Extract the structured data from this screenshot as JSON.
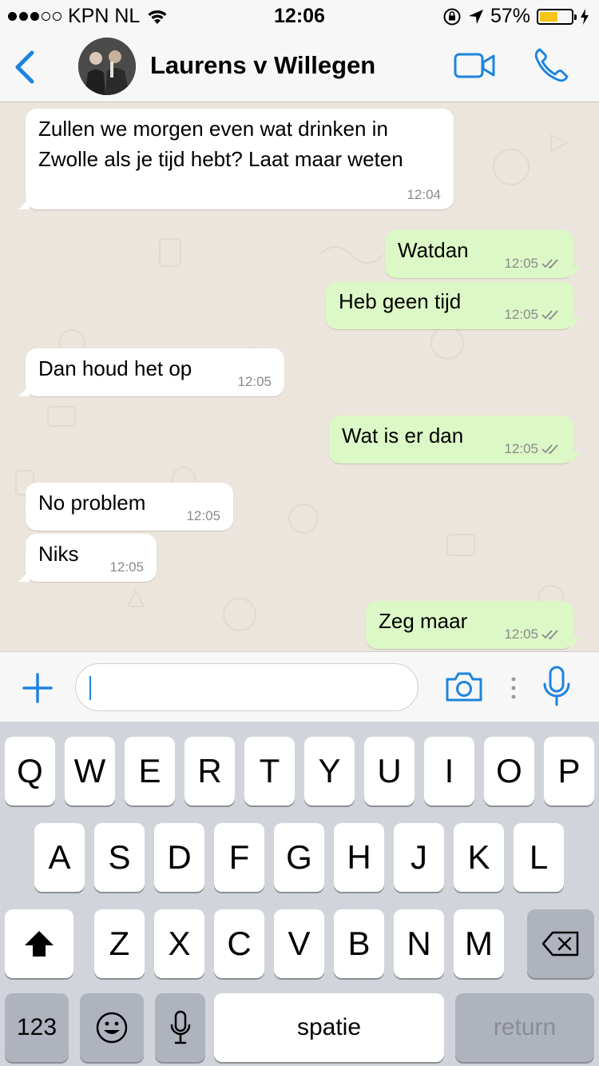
{
  "status_bar": {
    "carrier": "KPN NL",
    "time": "12:06",
    "battery_percent": "57%",
    "battery_level": 0.57,
    "signal_bars_filled": 3,
    "signal_bars_total": 5
  },
  "nav": {
    "contact_name": "Laurens v Willegen"
  },
  "messages": [
    {
      "direction": "incoming",
      "text": "Zullen we morgen even wat drinken in\nZwolle als je tijd hebt? Laat maar weten",
      "time": "12:04"
    },
    {
      "direction": "outgoing",
      "text": "Watdan",
      "time": "12:05",
      "read": true
    },
    {
      "direction": "outgoing",
      "text": "Heb geen tijd",
      "time": "12:05",
      "read": true
    },
    {
      "direction": "incoming",
      "text": "Dan houd het op",
      "time": "12:05"
    },
    {
      "direction": "outgoing",
      "text": "Wat is er dan",
      "time": "12:05",
      "read": true
    },
    {
      "direction": "incoming",
      "text": "No problem",
      "time": "12:05"
    },
    {
      "direction": "incoming",
      "text": "Niks",
      "time": "12:05"
    },
    {
      "direction": "outgoing",
      "text": "Zeg maar",
      "time": "12:05",
      "read": true
    }
  ],
  "input": {
    "value": "",
    "placeholder": ""
  },
  "keyboard": {
    "row1": [
      "Q",
      "W",
      "E",
      "R",
      "T",
      "Y",
      "U",
      "I",
      "O",
      "P"
    ],
    "row2": [
      "A",
      "S",
      "D",
      "F",
      "G",
      "H",
      "J",
      "K",
      "L"
    ],
    "row3": [
      "Z",
      "X",
      "C",
      "V",
      "B",
      "N",
      "M"
    ],
    "numbers_key": "123",
    "space_key": "spatie",
    "return_key": "return"
  },
  "colors": {
    "accent": "#1d84e0",
    "outgoing_bubble": "#dcf8c6",
    "incoming_bubble": "#ffffff",
    "chat_background": "#ece5dd",
    "read_ticks": "#4fb6ec"
  }
}
